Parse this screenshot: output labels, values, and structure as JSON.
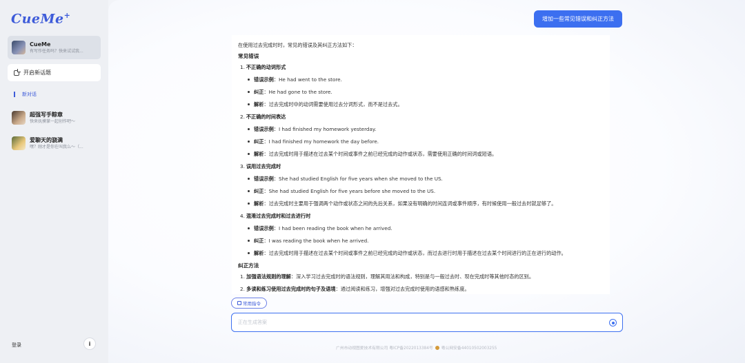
{
  "app": {
    "logo": "CueMe",
    "logo_mark": "+"
  },
  "sidebar": {
    "agent": {
      "name": "CueMe",
      "subtitle": "有写作任务吗？快来试试我..."
    },
    "new_topic": "开启新话题",
    "active_conversation": "新对话",
    "conversations": [
      {
        "title": "超强写手粽章",
        "subtitle": "快来抚摸掌一起创作吧～"
      },
      {
        "title": "爱聊天的骁满",
        "subtitle": "嘿？刚才是你在叫我么～（..."
      }
    ],
    "login": "登录",
    "info": "i"
  },
  "chat": {
    "user_message": "增加一些常见错误和纠正方法",
    "answer": {
      "intro": "在使用过去完成时时，常见的错误及其纠正方法如下：",
      "errors_heading": "常见错误",
      "errors": [
        {
          "num": "1.",
          "title": "不正确的动词形式",
          "example_label": "错误示例",
          "example": "：He had went to the store.",
          "fix_label": "纠正",
          "fix": "：He had gone to the store.",
          "analysis_label": "解析",
          "analysis": "：过去完成时中的动词需要使用过去分词形式，而不是过去式。"
        },
        {
          "num": "2.",
          "title": "不正确的时间表达",
          "example_label": "错误示例",
          "example": "：I had finished my homework yesterday.",
          "fix_label": "纠正",
          "fix": "：I had finished my homework the day before.",
          "analysis_label": "解析",
          "analysis": "：过去完成时用于描述在过去某个时间或事件之前已经完成的动作或状态，需要使用正确的时间词或短语。"
        },
        {
          "num": "3.",
          "title": "误用过去完成时",
          "example_label": "错误示例",
          "example": "：She had studied English for five years when she moved to the US.",
          "fix_label": "纠正",
          "fix": "：She had studied English for five years before she moved to the US.",
          "analysis_label": "解析",
          "analysis": "：过去完成时主要用于强调两个动作或状态之间的先后关系，如果没有明确的时间连词或事件顺序，有时候使用一般过去时就足够了。"
        },
        {
          "num": "4.",
          "title": "混淆过去完成时和过去进行时",
          "example_label": "错误示例",
          "example": "：I had been reading the book when he arrived.",
          "fix_label": "纠正",
          "fix": "：I was reading the book when he arrived.",
          "analysis_label": "解析",
          "analysis": "：过去完成时用于描述在过去某个时间或事件之前已经完成的动作或状态，而过去进行时用于描述在过去某个时间进行的正在进行的动作。"
        }
      ],
      "methods_heading": "纠正方法",
      "methods": [
        {
          "num": "1.",
          "title": "加强语法规则的理解",
          "text": "：深入学习过去完成时的语法规则，理解其用法和构成，特别是与一般过去时、现在完成时等其他时态的区别。"
        },
        {
          "num": "2.",
          "title": "多读和练习使用过去完成时的句子及语境",
          "text": "：通过阅读和练习，增强对过去完成时使用的语感和熟练度。"
        }
      ]
    },
    "common_commands": "常用指令",
    "input_placeholder": "正在生成答案",
    "footer_icp": "广州市动视图爱技术有限公司 粤ICP备2022013384号",
    "footer_police": "粤公网安备44010502003255"
  },
  "colors": {
    "accent": "#3c6ff0",
    "brand": "#3d5bd9"
  }
}
